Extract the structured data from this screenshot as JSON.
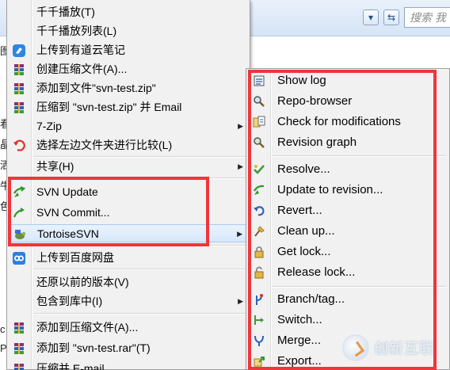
{
  "background": {
    "search_placeholder": "搜索 我",
    "left_fragments": [
      "图",
      "看",
      "晶",
      "洒",
      "牛",
      "色",
      "c",
      "P"
    ]
  },
  "menu": {
    "items": [
      {
        "label": "千千播放(T)",
        "icon": "",
        "arrow": false
      },
      {
        "label": "千千播放列表(L)",
        "icon": "",
        "arrow": false
      },
      {
        "label": "上传到有道云笔记",
        "icon": "youdao-note-icon",
        "arrow": false
      },
      {
        "label": "创建压缩文件(A)...",
        "icon": "winrar-icon",
        "arrow": false
      },
      {
        "label": "添加到文件\"svn-test.zip\"",
        "icon": "winrar-icon",
        "arrow": false
      },
      {
        "label": "压缩到 \"svn-test.zip\" 并 Email",
        "icon": "winrar-icon",
        "arrow": false
      },
      {
        "label": "7-Zip",
        "icon": "",
        "arrow": true
      },
      {
        "label": "选择左边文件夹进行比较(L)",
        "icon": "compare-icon",
        "arrow": false
      },
      {
        "label": "共享(H)",
        "icon": "",
        "arrow": true
      },
      {
        "label": "SVN Update",
        "icon": "svn-update-icon",
        "arrow": false
      },
      {
        "label": "SVN Commit...",
        "icon": "svn-commit-icon",
        "arrow": false
      },
      {
        "label": "TortoiseSVN",
        "icon": "tortoisesvn-icon",
        "arrow": true
      },
      {
        "label": "上传到百度网盘",
        "icon": "baidu-netdisk-icon",
        "arrow": false
      },
      {
        "label": "还原以前的版本(V)",
        "icon": "",
        "arrow": false
      },
      {
        "label": "包含到库中(I)",
        "icon": "",
        "arrow": true
      },
      {
        "label": "添加到压缩文件(A)...",
        "icon": "winrar-icon",
        "arrow": false
      },
      {
        "label": "添加到 \"svn-test.rar\"(T)",
        "icon": "winrar-icon",
        "arrow": false
      },
      {
        "label": "压缩并 E-mail...",
        "icon": "winrar-icon",
        "arrow": false
      }
    ]
  },
  "submenu": {
    "items": [
      {
        "label": "Show log",
        "icon": "show-log-icon"
      },
      {
        "label": "Repo-browser",
        "icon": "repo-browser-icon"
      },
      {
        "label": "Check for modifications",
        "icon": "check-modifications-icon"
      },
      {
        "label": "Revision graph",
        "icon": "revision-graph-icon"
      },
      {
        "label": "Resolve...",
        "icon": "resolve-icon"
      },
      {
        "label": "Update to revision...",
        "icon": "update-revision-icon"
      },
      {
        "label": "Revert...",
        "icon": "revert-icon"
      },
      {
        "label": "Clean up...",
        "icon": "cleanup-icon"
      },
      {
        "label": "Get lock...",
        "icon": "lock-icon"
      },
      {
        "label": "Release lock...",
        "icon": "unlock-icon"
      },
      {
        "label": "Branch/tag...",
        "icon": "branch-icon"
      },
      {
        "label": "Switch...",
        "icon": "switch-icon"
      },
      {
        "label": "Merge...",
        "icon": "merge-icon"
      },
      {
        "label": "Export...",
        "icon": "export-icon"
      }
    ]
  },
  "watermark": {
    "text": "创新互联"
  },
  "colors": {
    "highlight": "#f0353b",
    "menu_bg": "#f1f1f1",
    "hover_bg": "#d7e8fb"
  }
}
